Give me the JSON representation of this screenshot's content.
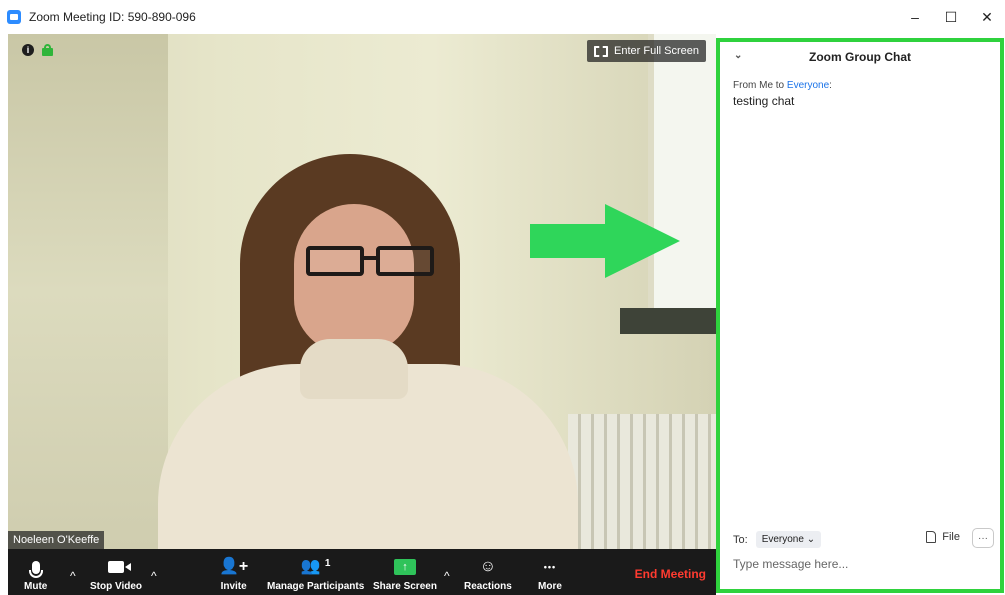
{
  "window": {
    "title": "Zoom Meeting ID: 590-890-096",
    "minimize_label": "–",
    "maximize_label": "☐",
    "close_label": "✕"
  },
  "video": {
    "fullscreen_label": "Enter Full Screen",
    "participant_name": "Noeleen O'Keeffe",
    "info_icon_label": "i",
    "arrow_color": "#2fd65a"
  },
  "toolbar": {
    "mute_label": "Mute",
    "stop_video_label": "Stop Video",
    "invite_label": "Invite",
    "manage_participants_label": "Manage Participants",
    "participant_count": "1",
    "share_screen_label": "Share Screen",
    "reactions_label": "Reactions",
    "more_label": "More",
    "end_meeting_label": "End Meeting",
    "caret": "^",
    "more_dots": "•••",
    "share_arrow": "↑",
    "reactions_glyph": "☺",
    "invite_glyph": "👤"
  },
  "chat": {
    "title": "Zoom Group Chat",
    "collapse_glyph": "⌄",
    "message": {
      "meta_prefix": "From Me to ",
      "recipient": "Everyone",
      "meta_suffix": ":",
      "text": "testing chat"
    },
    "to_label": "To:",
    "recipient_selector": "Everyone ⌄",
    "file_label": "File",
    "more_label": "···",
    "input_placeholder": "Type message here..."
  },
  "colors": {
    "chat_border": "#2fd23d",
    "end_meeting": "#ff3b30",
    "share_screen": "#2fc35a",
    "link_blue": "#1a73e8"
  }
}
